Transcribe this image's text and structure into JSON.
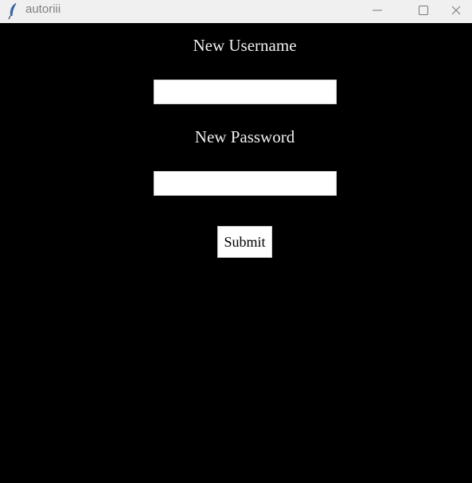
{
  "window": {
    "title": "autoriii",
    "app_icon": "feather-icon",
    "controls": [
      "minimize-icon",
      "maximize-icon",
      "close-icon"
    ]
  },
  "form": {
    "username_label": "New Username",
    "username_value": "",
    "password_label": "New Password",
    "password_value": "",
    "submit_label": "Submit"
  },
  "colors": {
    "background": "#000000",
    "label_text": "#f0f0f0",
    "titlebar": "#f0f0f0",
    "entry_bg": "#ffffff"
  }
}
